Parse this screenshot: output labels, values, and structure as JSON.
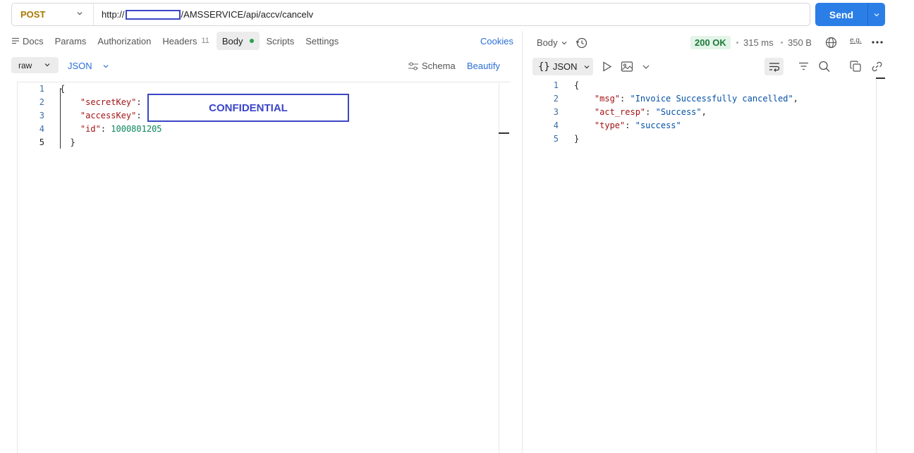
{
  "request": {
    "method": "POST",
    "url_prefix": "http://",
    "url_suffix": "/AMSSERVICE/api/accv/cancelv",
    "send_label": "Send"
  },
  "tabs": [
    {
      "label": "Docs"
    },
    {
      "label": "Params"
    },
    {
      "label": "Authorization"
    },
    {
      "label": "Headers",
      "count": "11"
    },
    {
      "label": "Body"
    },
    {
      "label": "Scripts"
    },
    {
      "label": "Settings"
    }
  ],
  "cookies_label": "Cookies",
  "body_options": {
    "mode": "raw",
    "language": "JSON",
    "schema_label": "Schema",
    "beautify_label": "Beautify"
  },
  "request_body": {
    "line_numbers": [
      "1",
      "2",
      "3",
      "4",
      "5"
    ],
    "open_brace": "{",
    "close_brace": "}",
    "key1": "\"secretKey\"",
    "key2": "\"accessKey\"",
    "key3": "\"id\"",
    "id_value": "1000801205",
    "colon": ":",
    "redaction_label": "CONFIDENTIAL"
  },
  "response": {
    "view_label": "Body",
    "status": "200 OK",
    "time": "315 ms",
    "size": "350 B",
    "format_label": "JSON",
    "example_label": "e.g.",
    "line_numbers": [
      "1",
      "2",
      "3",
      "4",
      "5"
    ],
    "open_brace": "{",
    "close_brace": "}",
    "k1": "\"msg\"",
    "v1": "\"Invoice Successfully cancelled\"",
    "k2": "\"act_resp\"",
    "v2": "\"Success\"",
    "k3": "\"type\"",
    "v3": "\"success\"",
    "colon_sp": ": ",
    "comma": ","
  },
  "colors": {
    "accent": "#2b7ee6",
    "method": "#a77a00",
    "status_ok": "#1d7a3a",
    "redaction": "#3b46c6"
  }
}
